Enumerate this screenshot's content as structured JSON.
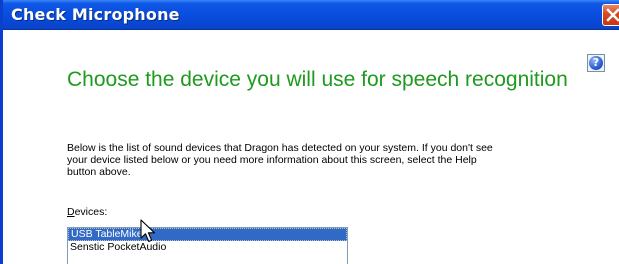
{
  "window": {
    "title": "Check Microphone"
  },
  "content": {
    "heading": "Choose the device you will use for speech recognition",
    "description_lines": [
      "Below is the list of sound devices that Dragon has detected on your system. If you don't see",
      "your device listed below or you need more information about this screen, select the Help",
      "button above."
    ],
    "devices_label_mnemonic": "D",
    "devices_label_rest": "evices:",
    "devices": [
      {
        "label": "USB TableMike",
        "selected": true
      },
      {
        "label": "Senstic PocketAudio",
        "selected": false
      }
    ]
  },
  "icons": {
    "close": "close-icon",
    "help": "help-icon",
    "cursor": "mouse-pointer-icon"
  },
  "colors": {
    "titlebar": "#0a4fe0",
    "heading": "#1e9a1e",
    "selection": "#316ac5",
    "close_button": "#d44a22"
  }
}
